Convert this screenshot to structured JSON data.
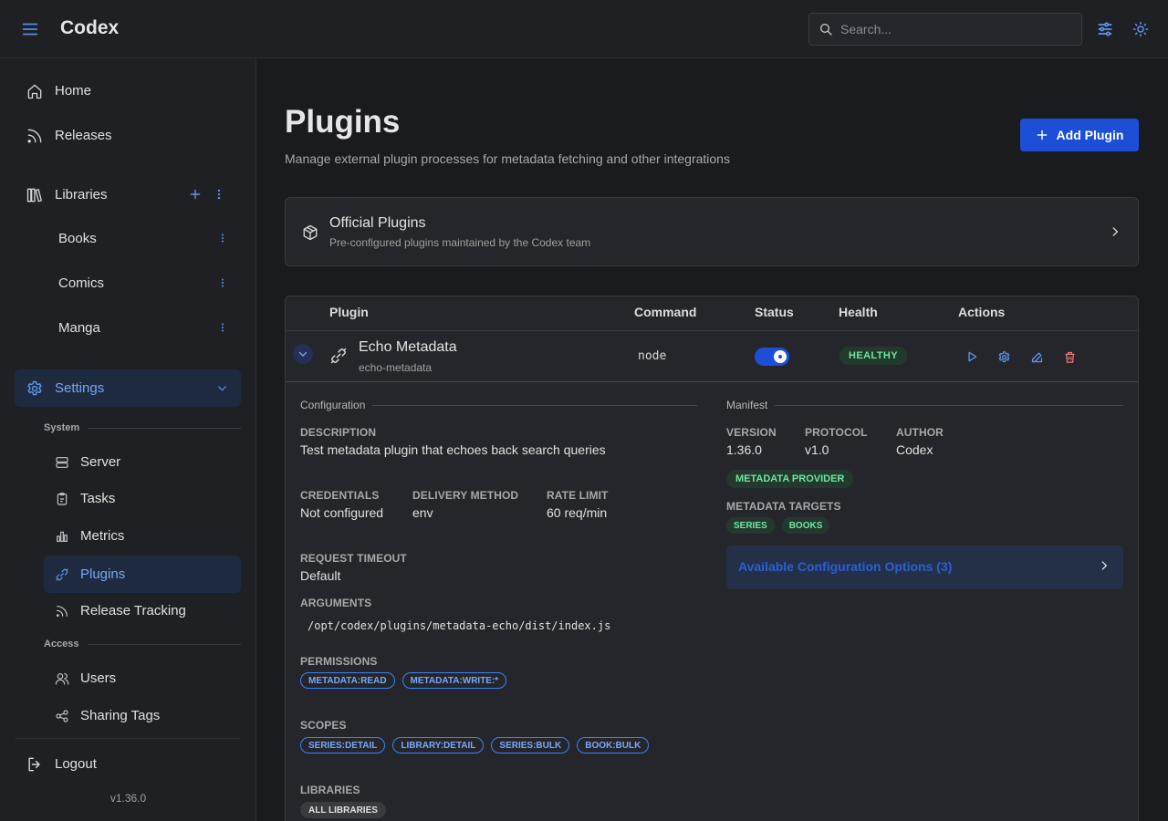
{
  "header": {
    "brand": "Codex",
    "search_placeholder": "Search..."
  },
  "sidebar": {
    "home": "Home",
    "releases": "Releases",
    "libraries": "Libraries",
    "library_items": [
      "Books",
      "Comics",
      "Manga"
    ],
    "settings": "Settings",
    "system_section": "System",
    "system_items": [
      "Server",
      "Tasks",
      "Metrics",
      "Plugins",
      "Release Tracking"
    ],
    "access_section": "Access",
    "access_items": [
      "Users",
      "Sharing Tags"
    ],
    "logout": "Logout",
    "version": "v1.36.0"
  },
  "page": {
    "title": "Plugins",
    "subtitle": "Manage external plugin processes for metadata fetching and other integrations",
    "add_button": "Add Plugin"
  },
  "official": {
    "title": "Official Plugins",
    "subtitle": "Pre-configured plugins maintained by the Codex team"
  },
  "table": {
    "columns": [
      "Plugin",
      "Command",
      "Status",
      "Health",
      "Actions"
    ],
    "row": {
      "name": "Echo Metadata",
      "slug": "echo-metadata",
      "command": "node",
      "enabled": true,
      "health": "HEALTHY"
    }
  },
  "configuration": {
    "legend": "Configuration",
    "description_label": "DESCRIPTION",
    "description": "Test metadata plugin that echoes back search queries",
    "credentials_label": "CREDENTIALS",
    "credentials": "Not configured",
    "delivery_label": "DELIVERY METHOD",
    "delivery": "env",
    "rate_label": "RATE LIMIT",
    "rate": "60 req/min",
    "timeout_label": "REQUEST TIMEOUT",
    "timeout": "Default",
    "arguments_label": "ARGUMENTS",
    "arguments": "/opt/codex/plugins/metadata-echo/dist/index.js",
    "permissions_label": "PERMISSIONS",
    "permissions": [
      "METADATA:READ",
      "METADATA:WRITE:*"
    ],
    "scopes_label": "SCOPES",
    "scopes": [
      "SERIES:DETAIL",
      "LIBRARY:DETAIL",
      "SERIES:BULK",
      "BOOK:BULK"
    ],
    "libraries_label": "LIBRARIES",
    "libraries": "ALL LIBRARIES"
  },
  "manifest": {
    "legend": "Manifest",
    "version_label": "VERSION",
    "version": "1.36.0",
    "protocol_label": "PROTOCOL",
    "protocol": "v1.0",
    "author_label": "AUTHOR",
    "author": "Codex",
    "capability": "METADATA PROVIDER",
    "targets_label": "METADATA TARGETS",
    "targets": [
      "SERIES",
      "BOOKS"
    ],
    "config_options": "Available Configuration Options (3)"
  },
  "colors": {
    "accent": "#1d4ed8",
    "accent_text": "#74a8f5",
    "success": "#6ee7a0"
  }
}
